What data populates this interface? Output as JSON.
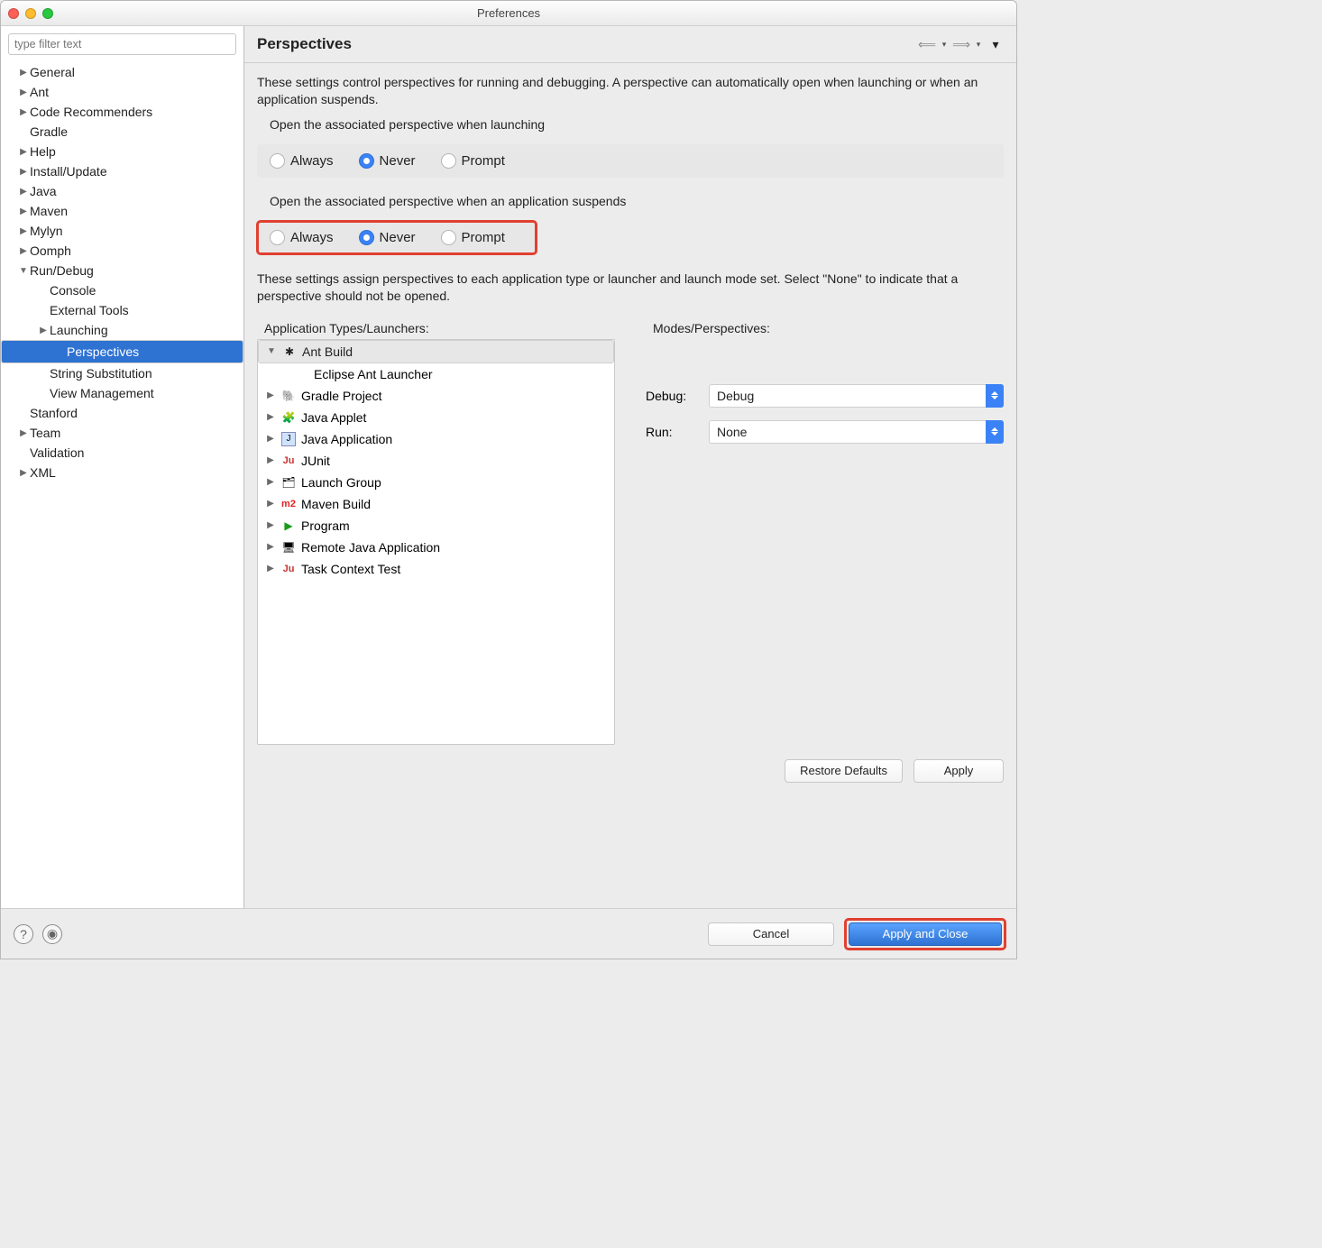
{
  "window": {
    "title": "Preferences"
  },
  "sidebar": {
    "filter_placeholder": "type filter text",
    "items": [
      {
        "label": "General",
        "disc": "▶",
        "level": 1
      },
      {
        "label": "Ant",
        "disc": "▶",
        "level": 1
      },
      {
        "label": "Code Recommenders",
        "disc": "▶",
        "level": 1
      },
      {
        "label": "Gradle",
        "disc": "",
        "level": 1
      },
      {
        "label": "Help",
        "disc": "▶",
        "level": 1
      },
      {
        "label": "Install/Update",
        "disc": "▶",
        "level": 1
      },
      {
        "label": "Java",
        "disc": "▶",
        "level": 1
      },
      {
        "label": "Maven",
        "disc": "▶",
        "level": 1
      },
      {
        "label": "Mylyn",
        "disc": "▶",
        "level": 1
      },
      {
        "label": "Oomph",
        "disc": "▶",
        "level": 1
      },
      {
        "label": "Run/Debug",
        "disc": "▼",
        "level": 1
      },
      {
        "label": "Console",
        "disc": "",
        "level": 2
      },
      {
        "label": "External Tools",
        "disc": "",
        "level": 2
      },
      {
        "label": "Launching",
        "disc": "▶",
        "level": 2
      },
      {
        "label": "Perspectives",
        "disc": "",
        "level": 3,
        "selected": true
      },
      {
        "label": "String Substitution",
        "disc": "",
        "level": 2
      },
      {
        "label": "View Management",
        "disc": "",
        "level": 2
      },
      {
        "label": "Stanford",
        "disc": "",
        "level": 1
      },
      {
        "label": "Team",
        "disc": "▶",
        "level": 1
      },
      {
        "label": "Validation",
        "disc": "",
        "level": 1
      },
      {
        "label": "XML",
        "disc": "▶",
        "level": 1
      }
    ]
  },
  "main": {
    "title": "Perspectives",
    "desc1": "These settings control perspectives for running and debugging. A perspective can automatically open when launching or when an application suspends.",
    "group1": {
      "label": "Open the associated perspective when launching",
      "options": {
        "always": "Always",
        "never": "Never",
        "prompt": "Prompt"
      },
      "selected": "never"
    },
    "group2": {
      "label": "Open the associated perspective when an application suspends",
      "options": {
        "always": "Always",
        "never": "Never",
        "prompt": "Prompt"
      },
      "selected": "never"
    },
    "desc2": "These settings assign perspectives to each application type or launcher and launch mode set. Select \"None\" to indicate that a perspective should not be opened.",
    "launchers_label": "Application Types/Launchers:",
    "modes_label": "Modes/Perspectives:",
    "launchers": [
      {
        "label": "Ant Build",
        "disc": "▼",
        "selected": true,
        "icon": "ant"
      },
      {
        "label": "Eclipse Ant Launcher",
        "disc": "",
        "indent": true
      },
      {
        "label": "Gradle Project",
        "disc": "▶",
        "icon": "gradle"
      },
      {
        "label": "Java Applet",
        "disc": "▶",
        "icon": "applet"
      },
      {
        "label": "Java Application",
        "disc": "▶",
        "icon": "javaapp"
      },
      {
        "label": "JUnit",
        "disc": "▶",
        "icon": "junit"
      },
      {
        "label": "Launch Group",
        "disc": "▶",
        "icon": "group"
      },
      {
        "label": "Maven Build",
        "disc": "▶",
        "icon": "maven"
      },
      {
        "label": "Program",
        "disc": "▶",
        "icon": "program"
      },
      {
        "label": "Remote Java Application",
        "disc": "▶",
        "icon": "remote"
      },
      {
        "label": "Task Context Test",
        "disc": "▶",
        "icon": "task"
      }
    ],
    "modes": {
      "debug_label": "Debug:",
      "run_label": "Run:",
      "debug_value": "Debug",
      "run_value": "None"
    },
    "buttons": {
      "restore": "Restore Defaults",
      "apply": "Apply"
    }
  },
  "footer": {
    "cancel": "Cancel",
    "apply_close": "Apply and Close"
  }
}
